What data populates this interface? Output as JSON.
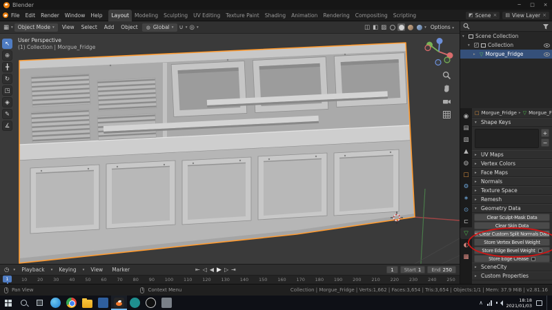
{
  "window": {
    "title": "Blender",
    "controls": {
      "minimize": "─",
      "maximize": "□",
      "close": "×"
    }
  },
  "icons": {
    "dropdown": "▾",
    "collapsed": "▸",
    "expanded": "▾",
    "scene": "◩",
    "view_layer": "▤",
    "unlink": "×",
    "globe": "◍",
    "magnet": "∪",
    "proportional": "◎",
    "editor_3d_viewport": "▦",
    "editor_timeline": "◷",
    "overlay_toggle_1": "◫",
    "overlay_toggle_2": "◧",
    "overlay_toggle_3": "▨",
    "check": "✓",
    "tray_chevron": "∧"
  },
  "colors": {
    "accent_blue": "#4f7cc2",
    "selection_orange": "#ff9b30",
    "annotation_red": "#cf1515",
    "mesh_data_green": "#4fc14f",
    "blender_orange": "#e87d0d"
  },
  "topbar": {
    "menus": [
      "File",
      "Edit",
      "Render",
      "Window",
      "Help"
    ],
    "workspaces": [
      {
        "label": "Layout",
        "active": true
      },
      {
        "label": "Modeling"
      },
      {
        "label": "Sculpting"
      },
      {
        "label": "UV Editing"
      },
      {
        "label": "Texture Paint"
      },
      {
        "label": "Shading"
      },
      {
        "label": "Animation"
      },
      {
        "label": "Rendering"
      },
      {
        "label": "Compositing"
      },
      {
        "label": "Scripting"
      }
    ],
    "scene": "Scene",
    "view_layer": "View Layer"
  },
  "viewport": {
    "header": {
      "mode": "Object Mode",
      "menus": [
        "View",
        "Select",
        "Add",
        "Object"
      ],
      "orientation": "Global",
      "options_label": "Options"
    },
    "overlay": {
      "line1": "User Perspective",
      "line2": "(1) Collection | Morgue_Fridge"
    },
    "tools": [
      {
        "name": "select-box-tool",
        "glyph": "↖"
      },
      {
        "name": "cursor-tool",
        "glyph": "⊕"
      },
      {
        "name": "move-tool",
        "glyph": "╋"
      },
      {
        "name": "rotate-tool",
        "glyph": "↻"
      },
      {
        "name": "scale-tool",
        "glyph": "◳"
      },
      {
        "name": "transform-tool",
        "glyph": "◈"
      },
      {
        "name": "annotate-tool",
        "glyph": "✎"
      },
      {
        "name": "measure-tool",
        "glyph": "∡"
      }
    ]
  },
  "outliner": {
    "rows": [
      {
        "label": "Scene Collection"
      },
      {
        "label": "Collection"
      },
      {
        "label": "Morgue_Fridge",
        "selected": true
      }
    ]
  },
  "properties": {
    "tabs": [
      {
        "name": "render",
        "glyph": "◉"
      },
      {
        "name": "output",
        "glyph": "▤"
      },
      {
        "name": "view-layer",
        "glyph": "▧"
      },
      {
        "name": "scene",
        "glyph": "▲"
      },
      {
        "name": "world",
        "glyph": "◍"
      },
      {
        "name": "object",
        "glyph": "□"
      },
      {
        "name": "modifiers",
        "glyph": "⚙"
      },
      {
        "name": "particles",
        "glyph": "∗"
      },
      {
        "name": "physics",
        "glyph": "⊙"
      },
      {
        "name": "constraints",
        "glyph": "⊏"
      },
      {
        "name": "object-data",
        "glyph": "▽",
        "active": true
      },
      {
        "name": "material",
        "glyph": "◐"
      },
      {
        "name": "texture",
        "glyph": "▩"
      }
    ],
    "breadcrumb": {
      "object": "Morgue_Fridge",
      "data": "Morgue_Frid"
    },
    "shape_keys": {
      "title": "Shape Keys",
      "add": "+",
      "remove": "−"
    },
    "collapsed_panels": [
      "UV Maps",
      "Vertex Colors",
      "Face Maps",
      "Normals",
      "Texture Space",
      "Remesh"
    ],
    "geometry_data": {
      "title": "Geometry Data",
      "items": [
        {
          "label": "Clear Sculpt-Mask Data"
        },
        {
          "label": "Clear Skin Data"
        },
        {
          "label": "Clear Custom Split Normals Data",
          "icon": "×"
        },
        {
          "label": "Store Vertex Bevel Weight"
        },
        {
          "label": "Store Edge Bevel Weight",
          "checkbox": true
        },
        {
          "label": "Store Edge Crease",
          "checkbox": true
        }
      ]
    },
    "bottom_panels": [
      "SceneCity",
      "Custom Properties"
    ]
  },
  "timeline": {
    "menus": [
      "Playback",
      "Keying",
      "View",
      "Marker"
    ],
    "transport": [
      {
        "name": "jump-to-start",
        "glyph": "⇤"
      },
      {
        "name": "prev-keyframe",
        "glyph": "◁"
      },
      {
        "name": "play-reverse",
        "glyph": "◀"
      },
      {
        "name": "play",
        "glyph": "▶"
      },
      {
        "name": "next-keyframe",
        "glyph": "▷"
      },
      {
        "name": "jump-to-end",
        "glyph": "⇥"
      }
    ],
    "current_frame": "1",
    "start_label": "Start",
    "start_value": "1",
    "end_label": "End",
    "end_value": "250",
    "playhead": "1",
    "ticks": [
      "1",
      "10",
      "20",
      "30",
      "40",
      "50",
      "60",
      "70",
      "80",
      "90",
      "100",
      "110",
      "120",
      "130",
      "140",
      "150",
      "160",
      "170",
      "180",
      "190",
      "200",
      "210",
      "220",
      "230",
      "240",
      "250"
    ]
  },
  "status_bar": {
    "hints": [
      "Pan View",
      "Context Menu"
    ],
    "stats": "Collection | Morgue_Fridge | Verts:1,662 | Faces:3,654 | Tris:3,654 | Objects:1/1 | Mem: 37.9 MiB | v2.81.16"
  },
  "taskbar": {
    "apps": [
      "edge",
      "chrome",
      "file-explorer",
      "blue-app",
      "blender",
      "teal-app",
      "obs",
      "gray-app"
    ],
    "time": "18:18",
    "date": "2021/01/03"
  }
}
